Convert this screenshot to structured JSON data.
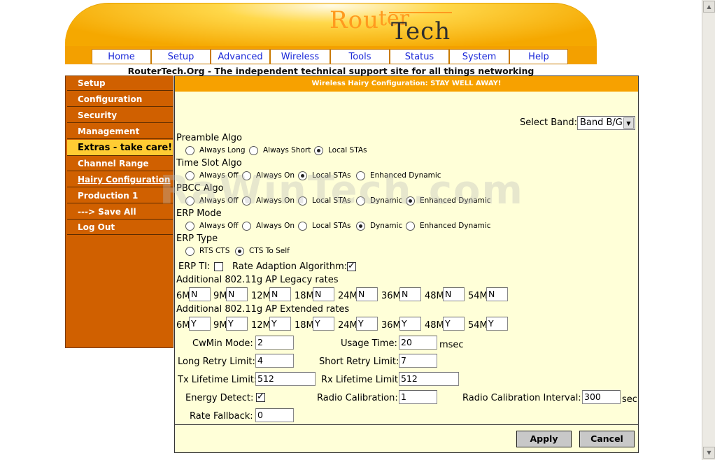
{
  "logo": {
    "part1": "Rou",
    "part2": "Tech",
    "top_text": "ter"
  },
  "nav": [
    "Home",
    "Setup",
    "Advanced",
    "Wireless",
    "Tools",
    "Status",
    "System",
    "Help"
  ],
  "tagline": "RouterTech.Org - The independent technical support site for all things networking",
  "sidebar": [
    {
      "label": "Setup"
    },
    {
      "label": "Configuration"
    },
    {
      "label": "Security"
    },
    {
      "label": "Management"
    },
    {
      "label": "Extras - take care!"
    },
    {
      "label": "Channel Range"
    },
    {
      "label": "Hairy Configuration"
    },
    {
      "label": "Production 1"
    },
    {
      "label": "---> Save All"
    },
    {
      "label": "Log Out"
    }
  ],
  "panel": {
    "title": "Wireless Hairy Configuration: STAY WELL AWAY!",
    "select_band_label": "Select Band:",
    "select_band_value": "Band B/G",
    "preamble": {
      "label": "Preamble Algo",
      "options": [
        "Always Long",
        "Always Short",
        "Local STAs"
      ]
    },
    "timeslot": {
      "label": "Time Slot Algo",
      "options": [
        "Always Off",
        "Always On",
        "Local STAs",
        "Enhanced Dynamic"
      ]
    },
    "pbcc": {
      "label": "PBCC Algo",
      "options": [
        "Always Off",
        "Always On",
        "Local STAs",
        "Dynamic",
        "Enhanced Dynamic"
      ]
    },
    "erpmode": {
      "label": "ERP Mode",
      "options": [
        "Always Off",
        "Always On",
        "Local STAs",
        "Dynamic",
        "Enhanced Dynamic"
      ]
    },
    "erptype": {
      "label": "ERP Type",
      "options": [
        "RTS CTS",
        "CTS To Self"
      ]
    },
    "erp_ti_label": "ERP TI:",
    "rate_adaption_label": "Rate Adaption Algorithm:",
    "legacy_label": "Additional 802.11g AP Legacy rates",
    "extended_label": "Additional 802.11g AP Extended rates",
    "rates": [
      "6M",
      "9M",
      "12M",
      "18M",
      "24M",
      "36M",
      "48M",
      "54M"
    ],
    "legacy_values": [
      "N",
      "N",
      "N",
      "N",
      "N",
      "N",
      "N",
      "N"
    ],
    "extended_values": [
      "Y",
      "Y",
      "Y",
      "Y",
      "Y",
      "Y",
      "Y",
      "Y"
    ],
    "cwmin_label": "CwMin Mode:",
    "cwmin_value": "2",
    "usage_label": "Usage Time:",
    "usage_value": "20",
    "usage_unit": "msec",
    "long_retry_label": "Long Retry Limit:",
    "long_retry_value": "4",
    "short_retry_label": "Short Retry Limit:",
    "short_retry_value": "7",
    "tx_life_label": "Tx Lifetime Limit:",
    "tx_life_value": "512",
    "rx_life_label": "Rx Lifetime Limit:",
    "rx_life_value": "512",
    "energy_label": "Energy Detect:",
    "radio_cal_label": "Radio Calibration:",
    "radio_cal_value": "1",
    "radio_int_label": "Radio Calibration Interval:",
    "radio_int_value": "300",
    "radio_int_unit": "sec",
    "rate_fallback_label": "Rate Fallback:",
    "rate_fallback_value": "0",
    "apply_label": "Apply",
    "cancel_label": "Cancel"
  },
  "watermark": "RaWinTech.com"
}
